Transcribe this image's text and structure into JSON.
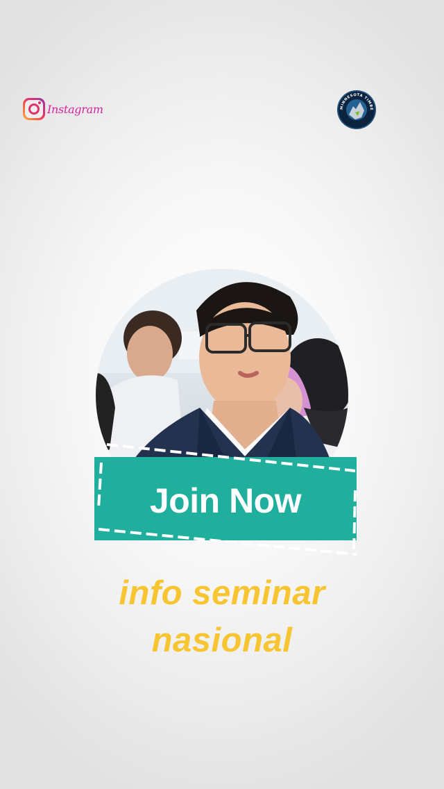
{
  "instagram_logo": {
    "icon": "instagram-icon",
    "wordmark": "Instagram"
  },
  "team_logo": {
    "icon": "minnesota-timberwolves-logo",
    "ring_text": "MINNESOTA TIMBERWOLVES"
  },
  "profile_photo": {
    "icon": "person-photo"
  },
  "cta": {
    "label": "Join Now",
    "color": "#1faf9c"
  },
  "caption": {
    "line1": "info seminar",
    "line2": "nasional",
    "color": "#f7c531"
  }
}
